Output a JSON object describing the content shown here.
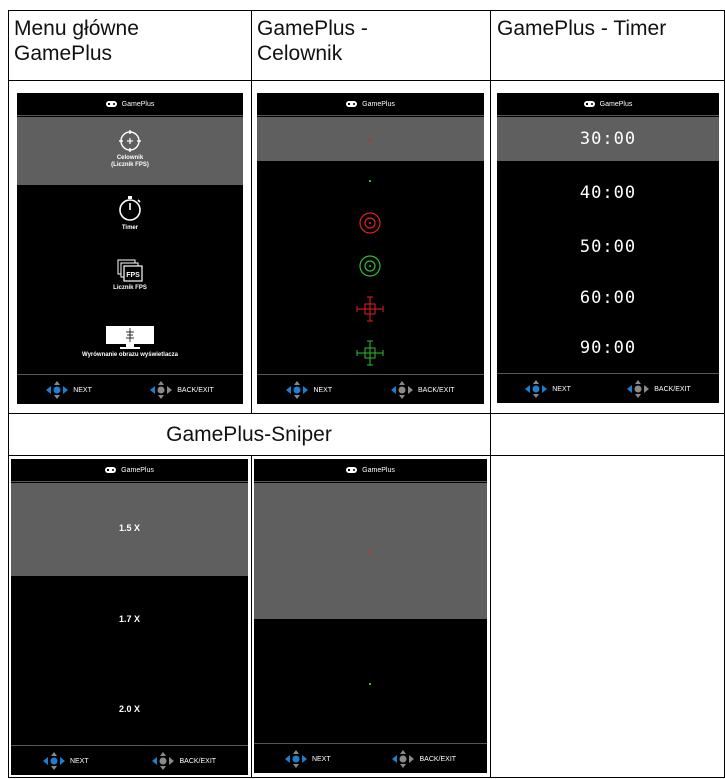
{
  "headers": {
    "main_menu": "Menu główne\nGamePlus",
    "crosshair": "GamePlus -\nCelownik",
    "timer": "GamePlus - Timer",
    "sniper": "GamePlus-Sniper"
  },
  "panel_title": "GamePlus",
  "footer": {
    "next": "NEXT",
    "back": "BACK/EXIT"
  },
  "menu_panel": {
    "items": [
      {
        "label": "Celownik\n(Licznik FPS)",
        "icon": "crosshair-icon"
      },
      {
        "label": "Timer",
        "icon": "stopwatch-icon"
      },
      {
        "label": "Licznik FPS",
        "icon": "fps-icon"
      },
      {
        "label": "Wyrównanie obrazu wyświetlacza",
        "icon": "display-alignment-icon"
      }
    ]
  },
  "crosshair_panel": {
    "crosshairs": [
      "dot-red",
      "dot-green",
      "circle-red",
      "circle-green",
      "cross-red",
      "cross-green"
    ]
  },
  "timer_panel": {
    "options": [
      "30:00",
      "40:00",
      "50:00",
      "60:00",
      "90:00"
    ]
  },
  "sniper_panel": {
    "options": [
      "1.5 X",
      "1.7 X",
      "2.0 X"
    ]
  },
  "colors": {
    "panel_bg": "#000000",
    "highlight": "#5f5f5f",
    "red": "#e02020",
    "green": "#2fbf2f",
    "dpad_blue": "#1e7fd0",
    "dpad_gray": "#8a8a8a"
  }
}
